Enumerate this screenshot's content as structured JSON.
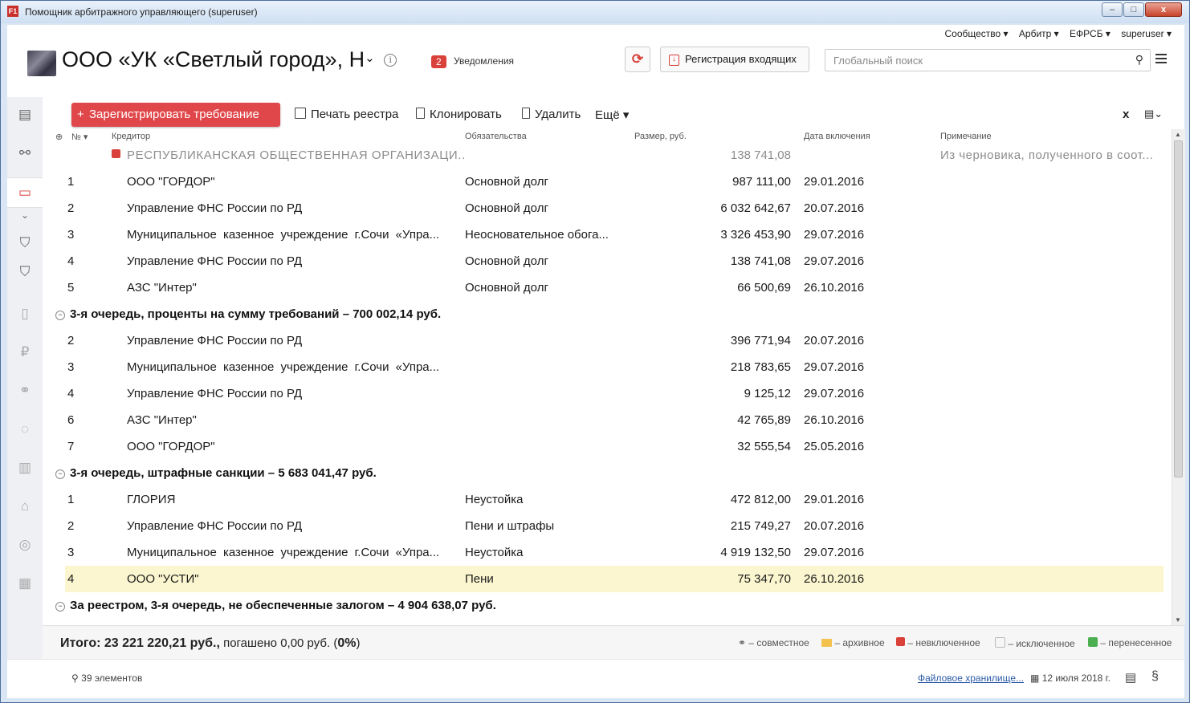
{
  "window": {
    "title": "Помощник арбитражного управляющего (superuser)",
    "app_icon": "F1",
    "buttons": {
      "minimize": "–",
      "maximize": "□",
      "close": "x"
    }
  },
  "topmenu": [
    "Сообщество ▾",
    "Арбитр ▾",
    "ЕФРСБ ▾",
    "superuser ▾"
  ],
  "header": {
    "company": "ООО «УК «Светлый город», Н",
    "notifications_count": "2",
    "notifications_label": "Уведомления",
    "register_incoming": "Регистрация входящих",
    "search_placeholder": "Глобальный поиск"
  },
  "toolbar": {
    "register_claim": "Зарегистрировать требование",
    "print_registry": "Печать реестра",
    "clone": "Клонировать",
    "delete": "Удалить",
    "more": "Ещё ▾",
    "close_x": "x"
  },
  "columns": {
    "num": "№",
    "creditor": "Кредитор",
    "obligation": "Обязательства",
    "amount": "Размер, руб.",
    "date": "Дата включения",
    "note": "Примечание"
  },
  "rows_top": [
    {
      "num": "",
      "creditor": "РЕСПУБЛИКАНСКАЯ ОБЩЕСТВЕННАЯ ОРГАНИЗАЦИ...",
      "obligation": "",
      "amount": "138 741,08",
      "date": "",
      "note": "Из черновика, полученного в соот..."
    },
    {
      "num": "1",
      "creditor": "ООО \"ГОРДОР\"",
      "obligation": "Основной долг",
      "amount": "987 111,00",
      "date": "29.01.2016",
      "note": ""
    },
    {
      "num": "2",
      "creditor": "Управление ФНС России по РД",
      "obligation": "Основной долг",
      "amount": "6 032 642,67",
      "date": "20.07.2016",
      "note": ""
    },
    {
      "num": "3",
      "creditor": "Муниципальное казенное учреждение г.Сочи «Упра...",
      "obligation": "Неосновательное обога...",
      "amount": "3 326 453,90",
      "date": "29.07.2016",
      "note": ""
    },
    {
      "num": "4",
      "creditor": "Управление ФНС России по РД",
      "obligation": "Основной долг",
      "amount": "138 741,08",
      "date": "29.07.2016",
      "note": ""
    },
    {
      "num": "5",
      "creditor": "АЗС \"Интер\"",
      "obligation": "Основной долг",
      "amount": "66 500,69",
      "date": "26.10.2016",
      "note": ""
    }
  ],
  "groups": [
    {
      "label": "3-я очередь, проценты на сумму требований – 700 002,14 руб."
    },
    {
      "label": "3-я очередь, штрафные санкции – 5 683 041,47 руб."
    },
    {
      "label": "За реестром, 3-я очередь, не обеспеченные залогом – 4 904 638,07 руб."
    }
  ],
  "rows_interest": [
    {
      "num": "2",
      "creditor": "Управление ФНС России по РД",
      "obligation": "",
      "amount": "396 771,94",
      "date": "20.07.2016"
    },
    {
      "num": "3",
      "creditor": "Муниципальное казенное учреждение г.Сочи «Упра...",
      "obligation": "",
      "amount": "218 783,65",
      "date": "29.07.2016"
    },
    {
      "num": "4",
      "creditor": "Управление ФНС России по РД",
      "obligation": "",
      "amount": "9 125,12",
      "date": "29.07.2016"
    },
    {
      "num": "6",
      "creditor": "АЗС \"Интер\"",
      "obligation": "",
      "amount": "42 765,89",
      "date": "26.10.2016"
    },
    {
      "num": "7",
      "creditor": "ООО \"ГОРДОР\"",
      "obligation": "",
      "amount": "32 555,54",
      "date": "25.05.2016"
    }
  ],
  "rows_penalty": [
    {
      "num": "1",
      "creditor": "ГЛОРИЯ",
      "obligation": "Неустойка",
      "amount": "472 812,00",
      "date": "29.01.2016"
    },
    {
      "num": "2",
      "creditor": "Управление ФНС России по РД",
      "obligation": "Пени и штрафы",
      "amount": "215 749,27",
      "date": "20.07.2016"
    },
    {
      "num": "3",
      "creditor": "Муниципальное казенное учреждение г.Сочи «Упра...",
      "obligation": "Неустойка",
      "amount": "4 919 132,50",
      "date": "29.07.2016"
    },
    {
      "num": "4",
      "creditor": "ООО \"УСТИ\"",
      "obligation": "Пени",
      "amount": "75 347,70",
      "date": "26.10.2016"
    }
  ],
  "footer": {
    "total_label": "Итого: 23 221 220,21 руб.,",
    "repaid": "погашено 0,00 руб. (",
    "repaid_pct": "0%",
    "repaid_close": ")",
    "legend_joint": "– совместное",
    "legend_archive": "– архивное",
    "legend_not_included": "– невключенное",
    "legend_excluded": "– исключенное",
    "legend_moved": "– перенесенное"
  },
  "statusbar": {
    "elements": "39 элементов",
    "file_storage": "Файловое хранилище...",
    "date": "12 июля 2018 г.",
    "section": "§"
  },
  "colors": {
    "accent": "#e0474a",
    "selected_row": "#fbf6cf"
  }
}
